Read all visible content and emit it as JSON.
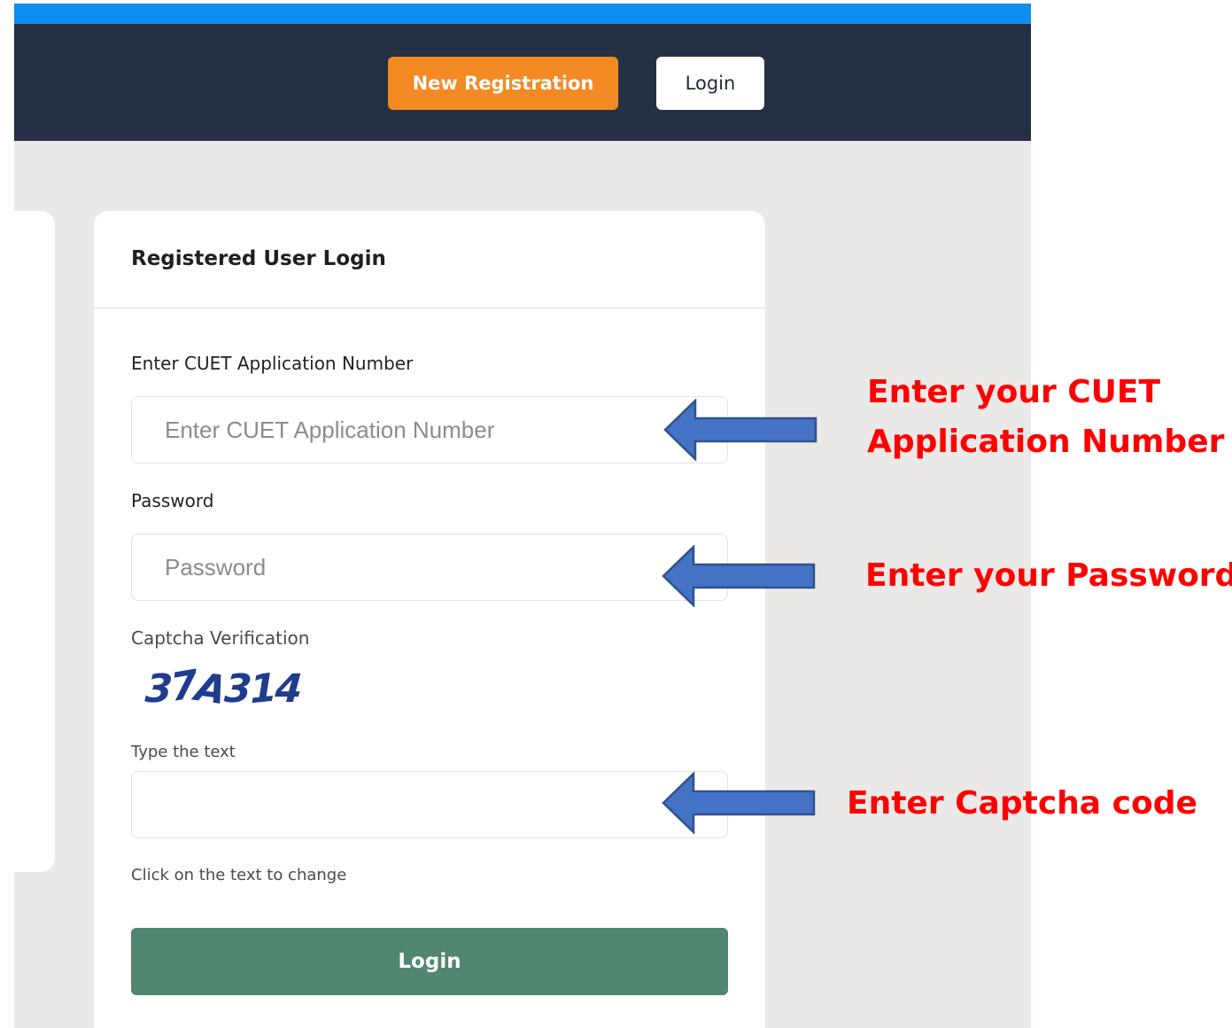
{
  "navbar": {
    "new_registration_label": "New Registration",
    "login_label": "Login"
  },
  "login_card": {
    "title": "Registered User Login",
    "application_number": {
      "label": "Enter CUET Application Number",
      "placeholder": "Enter CUET Application Number",
      "value": ""
    },
    "password": {
      "label": "Password",
      "placeholder": "Password",
      "value": ""
    },
    "captcha": {
      "label": "Captcha Verification",
      "chars": [
        "3",
        "7",
        "A",
        "3",
        "1",
        "4"
      ],
      "type_label": "Type the text",
      "value": "",
      "hint": "Click on the text to change"
    },
    "submit_label": "Login"
  },
  "annotations": {
    "callout_application": [
      "Enter your CUET",
      "Application Number"
    ],
    "callout_password": "Enter your Password",
    "callout_captcha": "Enter Captcha code",
    "arrow_color": "#4472c4",
    "arrow_stroke": "#2f528f",
    "text_color": "#ff0000"
  },
  "colors": {
    "top_stripe": "#0d8ef0",
    "navbar_bg": "#253044",
    "page_bg": "#ebe9e7",
    "new_registration_bg": "#f38a23",
    "submit_bg": "#50876e",
    "captcha_color": "#1f3c8f"
  }
}
